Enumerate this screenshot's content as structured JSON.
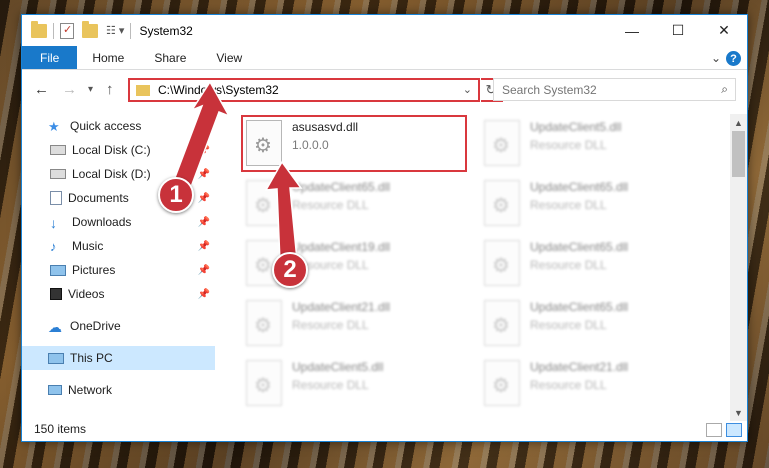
{
  "window": {
    "title": "System32",
    "minimize": "—",
    "maximize": "☐",
    "close": "✕"
  },
  "ribbon": {
    "tabs": [
      "File",
      "Home",
      "Share",
      "View"
    ],
    "help": "?"
  },
  "nav": {
    "back": "←",
    "forward": "→",
    "recent": "▾",
    "up": "↑",
    "address": "C:\\Windows\\System32",
    "refresh": "↻",
    "search_placeholder": "Search System32"
  },
  "sidebar": {
    "items": [
      {
        "label": "Quick access",
        "icon": "star-icon"
      },
      {
        "label": "Local Disk (C:)",
        "icon": "drive-icon",
        "pinned": true
      },
      {
        "label": "Local Disk (D:)",
        "icon": "drive-icon",
        "pinned": true
      },
      {
        "label": "Documents",
        "icon": "documents-icon",
        "pinned": true
      },
      {
        "label": "Downloads",
        "icon": "download-icon",
        "pinned": true
      },
      {
        "label": "Music",
        "icon": "music-icon",
        "pinned": true
      },
      {
        "label": "Pictures",
        "icon": "pictures-icon",
        "pinned": true
      },
      {
        "label": "Videos",
        "icon": "videos-icon",
        "pinned": true
      },
      {
        "label": "OneDrive",
        "icon": "cloud-icon"
      },
      {
        "label": "This PC",
        "icon": "computer-icon",
        "selected": true
      },
      {
        "label": "Network",
        "icon": "network-icon"
      }
    ]
  },
  "files": [
    {
      "name": "asusasvd.dll",
      "sub": "1.0.0.0",
      "blurred": false
    },
    {
      "name": "UpdateClient5.dll",
      "sub": "Resource DLL",
      "blurred": true
    },
    {
      "name": "UpdateClient65.dll",
      "sub": "Resource DLL",
      "blurred": true
    },
    {
      "name": "UpdateClient65.dll",
      "sub": "Resource DLL",
      "blurred": true
    },
    {
      "name": "UpdateClient19.dll",
      "sub": "Resource DLL",
      "blurred": true
    },
    {
      "name": "UpdateClient65.dll",
      "sub": "Resource DLL",
      "blurred": true
    },
    {
      "name": "UpdateClient21.dll",
      "sub": "Resource DLL",
      "blurred": true
    },
    {
      "name": "UpdateClient65.dll",
      "sub": "Resource DLL",
      "blurred": true
    },
    {
      "name": "UpdateClient5.dll",
      "sub": "Resource DLL",
      "blurred": true
    },
    {
      "name": "UpdateClient21.dll",
      "sub": "Resource DLL",
      "blurred": true
    }
  ],
  "status": {
    "count": "150 items"
  },
  "annotations": {
    "badge1": "1",
    "badge2": "2",
    "color": "#d9383e"
  }
}
